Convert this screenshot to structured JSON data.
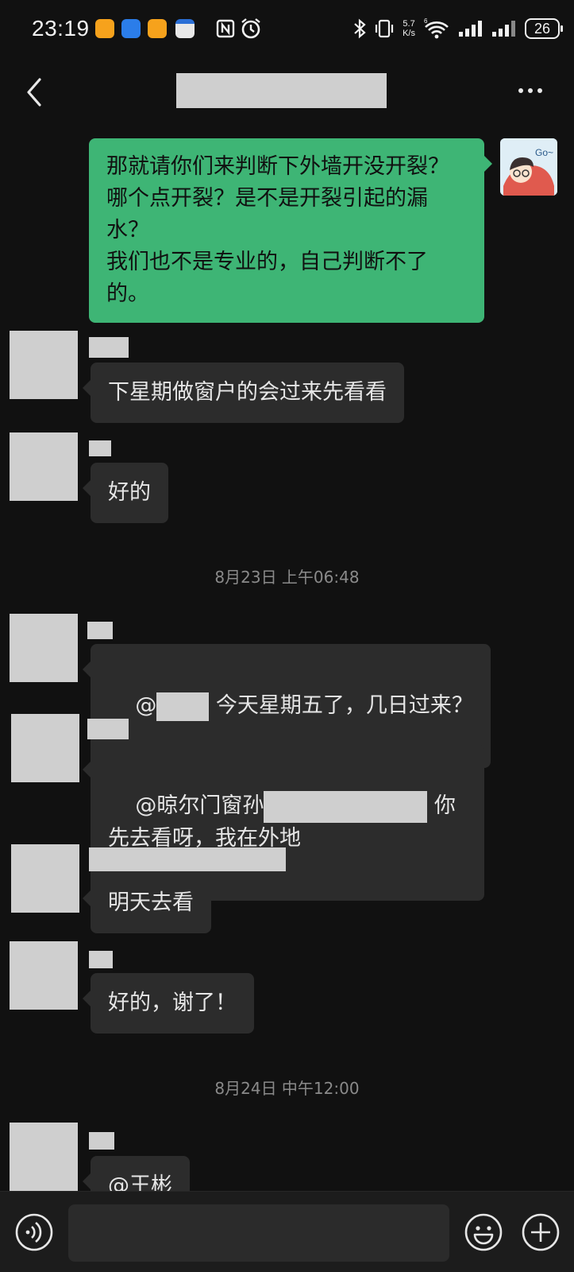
{
  "status_bar": {
    "time": "23:19",
    "net_speed_value": "5.7",
    "net_speed_unit": "K/s",
    "battery": "26",
    "icons": [
      "nfc-icon",
      "alarm-icon",
      "bluetooth-icon",
      "vibrate-icon",
      "wifi6-icon",
      "signal-icon",
      "signal-icon",
      "battery-icon"
    ]
  },
  "header": {
    "back_icon": "chevron-left-icon",
    "more_icon": "more-horizontal-icon"
  },
  "messages": [
    {
      "sender": "me",
      "text": "那就请你们来判断下外墙开没开裂？哪个点开裂？是不是开裂引起的漏水？\n我们也不是专业的，自己判断不了的。"
    },
    {
      "sender": "other",
      "text": "下星期做窗户的会过来先看看"
    },
    {
      "sender": "other",
      "text": "好的"
    },
    {
      "type": "timestamp",
      "text": "8月23日 上午06:48"
    },
    {
      "sender": "other",
      "prefix": "@",
      "suffix": " 今天星期五了，几日过来？"
    },
    {
      "sender": "other",
      "prefix": "@晾尔门窗孙",
      "suffix": " 你先去看呀，我在外地"
    },
    {
      "sender": "other",
      "text": "明天去看"
    },
    {
      "sender": "other",
      "text": "好的，谢了！"
    },
    {
      "type": "timestamp",
      "text": "8月24日 中午12:00"
    },
    {
      "sender": "other",
      "text": "@王彬"
    }
  ],
  "input_bar": {
    "voice_icon": "voice-icon",
    "emoji_icon": "emoji-icon",
    "plus_icon": "plus-circle-icon",
    "placeholder": ""
  },
  "colors": {
    "background": "#111111",
    "my_bubble": "#3eb575",
    "other_bubble": "#2c2c2c",
    "redaction": "#cfcfcf"
  }
}
